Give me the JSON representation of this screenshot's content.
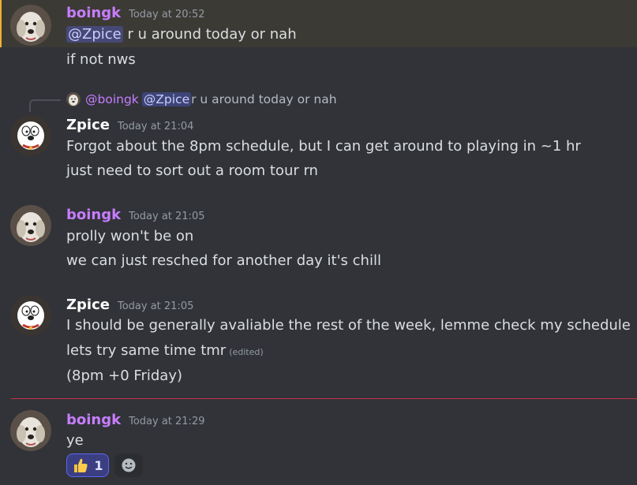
{
  "colors": {
    "boingk_name": "#c77dff",
    "zpice_name": "#ffffff",
    "text": "#dbdee1",
    "timestamp": "#949ba4",
    "highlight_bg": "#3c3a35",
    "new_divider": "#c8324a",
    "reaction_bg": "#3b3f82"
  },
  "messages": [
    {
      "author": "boingk",
      "time": "Today at 20:52",
      "lines": [
        {
          "mention": "@Zpice",
          "text": " r u around today or nah"
        },
        {
          "text": "if not nws"
        }
      ]
    },
    {
      "reply": {
        "author": "@boingk",
        "mention": "@Zpice",
        "text": " r u around today or nah"
      },
      "author": "Zpice",
      "time": "Today at 21:04",
      "lines": [
        {
          "text": "Forgot about the 8pm schedule, but I can get around to playing in ~1 hr"
        },
        {
          "text": "just need to sort out a room tour rn"
        }
      ]
    },
    {
      "author": "boingk",
      "time": "Today at 21:05",
      "lines": [
        {
          "text": "prolly won't be on"
        },
        {
          "text": "we can just resched for another day it's chill"
        }
      ]
    },
    {
      "author": "Zpice",
      "time": "Today at 21:05",
      "lines": [
        {
          "text": "I should be generally avaliable the rest of the week, lemme check my schedule"
        },
        {
          "text": "lets try same time tmr",
          "edited": "(edited)"
        },
        {
          "text": "(8pm +0 Friday)"
        }
      ]
    },
    {
      "author": "boingk",
      "time": "Today at 21:29",
      "lines": [
        {
          "text": "ye"
        }
      ],
      "reactions": [
        {
          "emoji": "thumbs-up-icon",
          "count": "1"
        }
      ]
    }
  ]
}
